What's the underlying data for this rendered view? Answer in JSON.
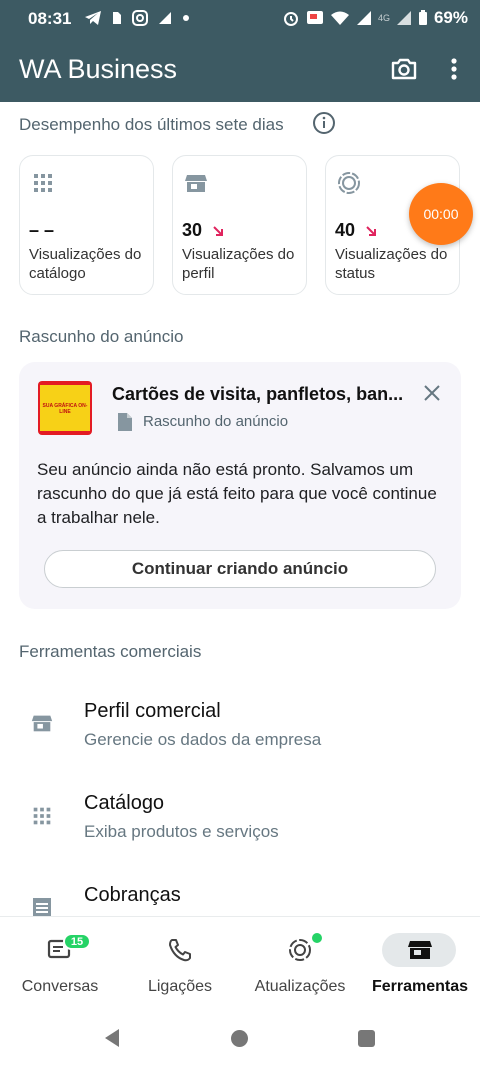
{
  "status_bar": {
    "time": "08:31",
    "battery_percent": "69%",
    "network_label": "4G"
  },
  "app_bar": {
    "title": "WA Business",
    "camera_icon": "camera-icon",
    "menu_icon": "more-vert-icon"
  },
  "performance": {
    "title": "Desempenho dos últimos sete dias",
    "cards": [
      {
        "icon": "grid-icon",
        "value": "– –",
        "label": "Visualizações do catálogo",
        "trend": ""
      },
      {
        "icon": "store-icon",
        "value": "30",
        "label": "Visualizações do perfil",
        "trend": "down"
      },
      {
        "icon": "status-icon",
        "value": "40",
        "label": "Visualizações do status",
        "trend": "down"
      }
    ]
  },
  "timer": {
    "label": "00:00"
  },
  "draft": {
    "section_title": "Rascunho do anúncio",
    "title": "Cartões de visita, panfletos, ban...",
    "subtitle": "Rascunho do anúncio",
    "body": "Seu anúncio ainda não está pronto. Salvamos um rascunho do que já está feito para que você continue a trabalhar nele.",
    "button": "Continuar criando anúncio",
    "thumb_text": "SUA GRÁFICA ON-LINE"
  },
  "tools": {
    "section_title": "Ferramentas comerciais",
    "items": [
      {
        "icon": "store-icon",
        "title": "Perfil comercial",
        "subtitle": "Gerencie os dados da empresa"
      },
      {
        "icon": "grid-icon",
        "title": "Catálogo",
        "subtitle": "Exiba produtos e serviços"
      },
      {
        "icon": "receipt-icon",
        "title": "Cobranças",
        "subtitle": ""
      }
    ]
  },
  "bottom_nav": {
    "items": [
      {
        "label": "Conversas",
        "badge": "15"
      },
      {
        "label": "Ligações"
      },
      {
        "label": "Atualizações"
      },
      {
        "label": "Ferramentas",
        "active": true
      }
    ]
  },
  "colors": {
    "header": "#3d5a63",
    "accent_green": "#25d366",
    "timer": "#ff7a18",
    "trend_down": "#e0245e"
  }
}
